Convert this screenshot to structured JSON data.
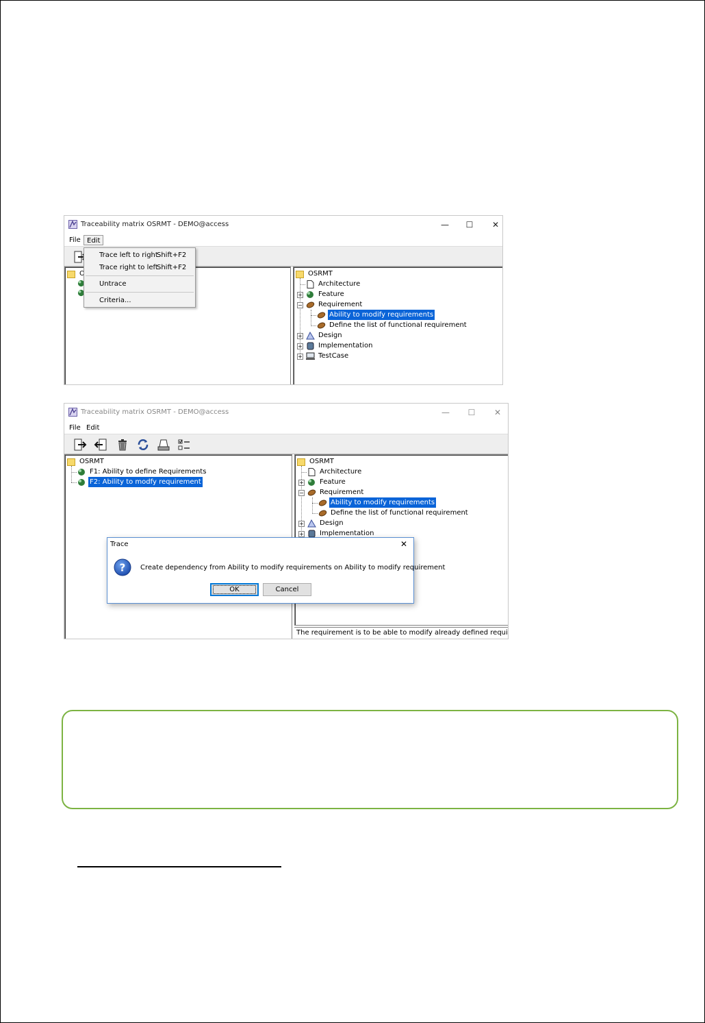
{
  "window1": {
    "title": "Traceability matrix OSRMT - DEMO@access",
    "controls": {
      "minimize": "—",
      "maximize": "☐",
      "close": "✕"
    },
    "menu": {
      "file": "File",
      "edit": "Edit"
    },
    "edit_menu": [
      {
        "label": "Trace left to right",
        "shortcut": "Shift+F2"
      },
      {
        "label": "Trace right to left",
        "shortcut": "Shift+F2"
      },
      {
        "label": "Untrace",
        "shortcut": ""
      },
      {
        "label": "Criteria...",
        "shortcut": ""
      }
    ],
    "left_tree_partial": "OS",
    "right_tree": {
      "root": "OSRMT",
      "architecture": "Architecture",
      "feature": "Feature",
      "requirement": "Requirement",
      "req_1": "Ability to modify requirements",
      "req_2": "Define the list of functional requirement",
      "design": "Design",
      "implementation": "Implementation",
      "testcase": "TestCase"
    }
  },
  "window2": {
    "title": "Traceability matrix OSRMT - DEMO@access",
    "controls": {
      "minimize": "—",
      "maximize": "☐",
      "close": "✕"
    },
    "menu": {
      "file": "File",
      "edit": "Edit"
    },
    "left_tree": {
      "root": "OSRMT",
      "f1": "F1: Ability to define Requirements",
      "f2": "F2: Ability to modfy requirement"
    },
    "right_tree": {
      "root": "OSRMT",
      "architecture": "Architecture",
      "feature": "Feature",
      "requirement": "Requirement",
      "req_1": "Ability to modify requirements",
      "req_2": "Define the list of functional requirement",
      "design": "Design",
      "implementation": "Implementation"
    },
    "status_text": "The requirement is to be able to modify already defined requirement"
  },
  "dialog": {
    "title": "Trace",
    "close": "✕",
    "message": "Create dependency from Ability to modify requirements on Ability to modify requirement",
    "ok_label": "OK",
    "cancel_label": "Cancel"
  },
  "colors": {
    "selection": "#0a64d8",
    "note_border": "#7cb342",
    "dialog_border": "#5a8fd2"
  }
}
